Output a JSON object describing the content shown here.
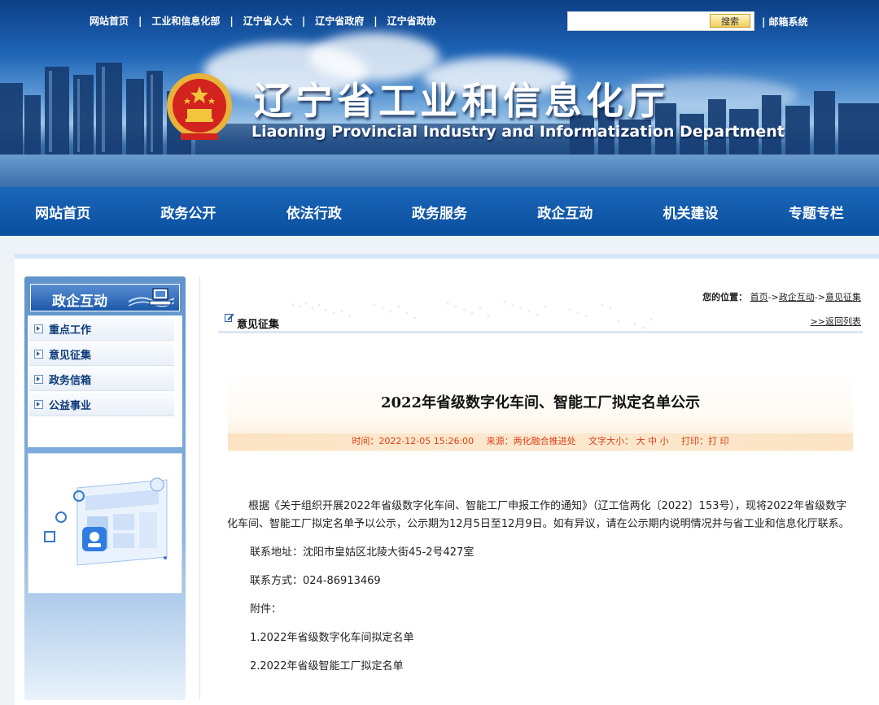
{
  "header": {
    "top_links": [
      "网站首页",
      "工业和信息化部",
      "辽宁省人大",
      "辽宁省政府",
      "辽宁省政协"
    ],
    "separator": "|",
    "search_button": "搜索",
    "mail_link": "| 邮箱系统",
    "title": "辽宁省工业和信息化厅",
    "subtitle": "Liaoning Provincial Industry and Informatization Department"
  },
  "nav": [
    "网站首页",
    "政务公开",
    "依法行政",
    "政务服务",
    "政企互动",
    "机关建设",
    "专题专栏"
  ],
  "sidebar": {
    "title": "政企互动",
    "items": [
      "重点工作",
      "意见征集",
      "政务信箱",
      "公益事业"
    ]
  },
  "location": {
    "label": "您的位置：",
    "crumbs": [
      "首页",
      "政企互动",
      "意见征集"
    ],
    "arrow": "->"
  },
  "section": {
    "title": "意见征集",
    "back_link": ">>返回列表"
  },
  "article": {
    "title": "2022年省级数字化车间、智能工厂拟定名单公示",
    "time": "时间：2022-12-05 15:26:00",
    "source": "来源：两化融合推进处",
    "font_size": "文字大小： 大 中 小",
    "print": "打印：打 印",
    "body": [
      "根据《关于组织开展2022年省级数字化车间、智能工厂申报工作的通知》（辽工信两化〔2022〕153号），现将2022年省级数字化车间、智能工厂拟定名单予以公示，公示期为12月5日至12月9日。如有异议，请在公示期内说明情况并与省工业和信息化厅联系。",
      "联系地址：沈阳市皇姑区北陵大街45-2号427室",
      "联系方式：024-86913469",
      "附件：",
      "1.2022年省级数字化车间拟定名单",
      "2.2022年省级智能工厂拟定名单"
    ]
  },
  "colors": {
    "nav_bg": "#0b4f9f",
    "meta_text": "#d9411b",
    "link": "#0d3a7a"
  }
}
